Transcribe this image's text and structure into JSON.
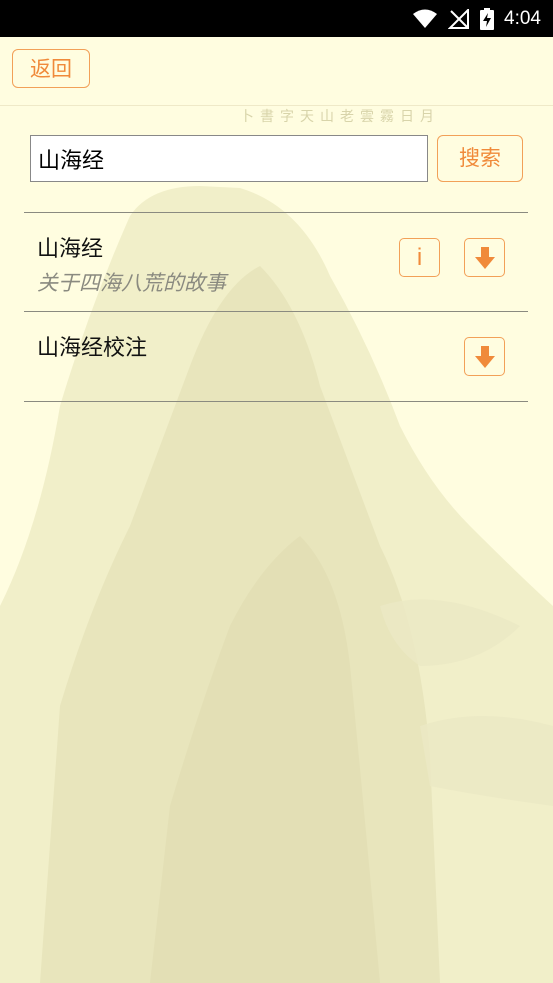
{
  "status_bar": {
    "time": "4:04"
  },
  "header": {
    "back_label": "返回"
  },
  "search": {
    "value": "山海经",
    "button_label": "搜索"
  },
  "results": [
    {
      "title": "山海经",
      "description": "关于四海八荒的故事",
      "has_info": true,
      "has_download": true
    },
    {
      "title": "山海经校注",
      "description": "",
      "has_info": false,
      "has_download": true
    }
  ],
  "colors": {
    "accent": "#f08a3a",
    "background": "#fffde0"
  },
  "icons": {
    "info": "info-icon",
    "download": "download-arrow-icon"
  }
}
